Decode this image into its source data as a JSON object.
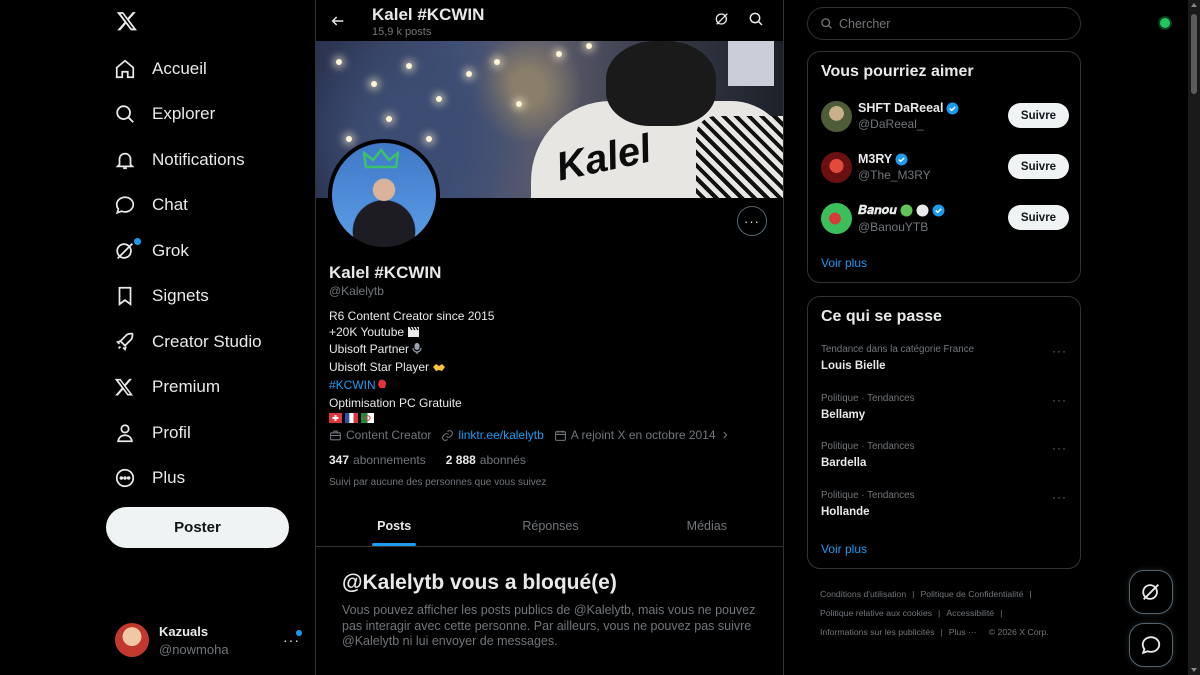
{
  "nav": {
    "items": [
      {
        "label": "Accueil",
        "icon": "home-icon"
      },
      {
        "label": "Explorer",
        "icon": "search-icon"
      },
      {
        "label": "Notifications",
        "icon": "bell-icon"
      },
      {
        "label": "Chat",
        "icon": "chat-bubble-icon"
      },
      {
        "label": "Grok",
        "icon": "grok-icon"
      },
      {
        "label": "Signets",
        "icon": "bookmark-icon"
      },
      {
        "label": "Creator Studio",
        "icon": "rocket-icon"
      },
      {
        "label": "Premium",
        "icon": "x-logo-icon"
      },
      {
        "label": "Profil",
        "icon": "person-icon"
      },
      {
        "label": "Plus",
        "icon": "more-circle-icon"
      }
    ],
    "post_button": "Poster"
  },
  "account": {
    "name": "Kazuals",
    "handle": "@nowmoha"
  },
  "header": {
    "title": "Kalel #KCWIN",
    "posts_count": "15,9 k posts"
  },
  "profile": {
    "name": "Kalel #KCWIN",
    "handle": "@Kalelytb",
    "banner_text": "Kalel",
    "bio": {
      "line1": "R6 Content Creator since 2015",
      "line2": "+20K Youtube",
      "line3": "Ubisoft Partner",
      "line4": "Ubisoft Star Player",
      "tag": "#KCWIN",
      "line6": "Optimisation PC Gratuite"
    },
    "category": "Content Creator",
    "link": "linktr.ee/kalelytb",
    "joined": "A rejoint X en octobre 2014",
    "following_count": "347",
    "following_label": "abonnements",
    "followers_count": "2 888",
    "followers_label": "abonnés",
    "followed_by": "Suivi par aucune des personnes que vous suivez"
  },
  "tabs": [
    "Posts",
    "Réponses",
    "Médias"
  ],
  "blocked": {
    "title": "@Kalelytb vous a bloqué(e)",
    "text": "Vous pouvez afficher les posts publics de @Kalelytb, mais vous ne pouvez pas interagir avec cette personne. Par ailleurs, vous ne pouvez pas suivre @Kalelytb ni lui envoyer de messages."
  },
  "search": {
    "placeholder": "Chercher"
  },
  "who_to_follow": {
    "title": "Vous pourriez aimer",
    "users": [
      {
        "name": "SHFT DaReeal",
        "handle": "@DaReeal_",
        "button": "Suivre"
      },
      {
        "name": "M3RY",
        "handle": "@The_M3RY",
        "button": "Suivre"
      },
      {
        "name": "𝑩𝒂𝒏𝒐𝒖",
        "handle": "@BanouYTB",
        "button": "Suivre"
      }
    ],
    "see_more": "Voir plus"
  },
  "trends": {
    "title": "Ce qui se passe",
    "items": [
      {
        "context": "Tendance dans la catégorie France",
        "name": "Louis Bielle"
      },
      {
        "context": "Politique · Tendances",
        "name": "Bellamy"
      },
      {
        "context": "Politique · Tendances",
        "name": "Bardella"
      },
      {
        "context": "Politique · Tendances",
        "name": "Hollande"
      }
    ],
    "see_more": "Voir plus"
  },
  "footer": {
    "terms": "Conditions d'utilisation",
    "privacy": "Politique de Confidentialité",
    "cookies": "Politique relative aux cookies",
    "accessibility": "Accessibilité",
    "ads": "Informations sur les publicités",
    "more": "Plus ···",
    "copyright": "© 2026 X Corp."
  },
  "colors": {
    "accent": "#1d9bf0",
    "background": "#000000",
    "border": "#2f3336",
    "muted": "#71767b",
    "status": "#22c55e"
  }
}
